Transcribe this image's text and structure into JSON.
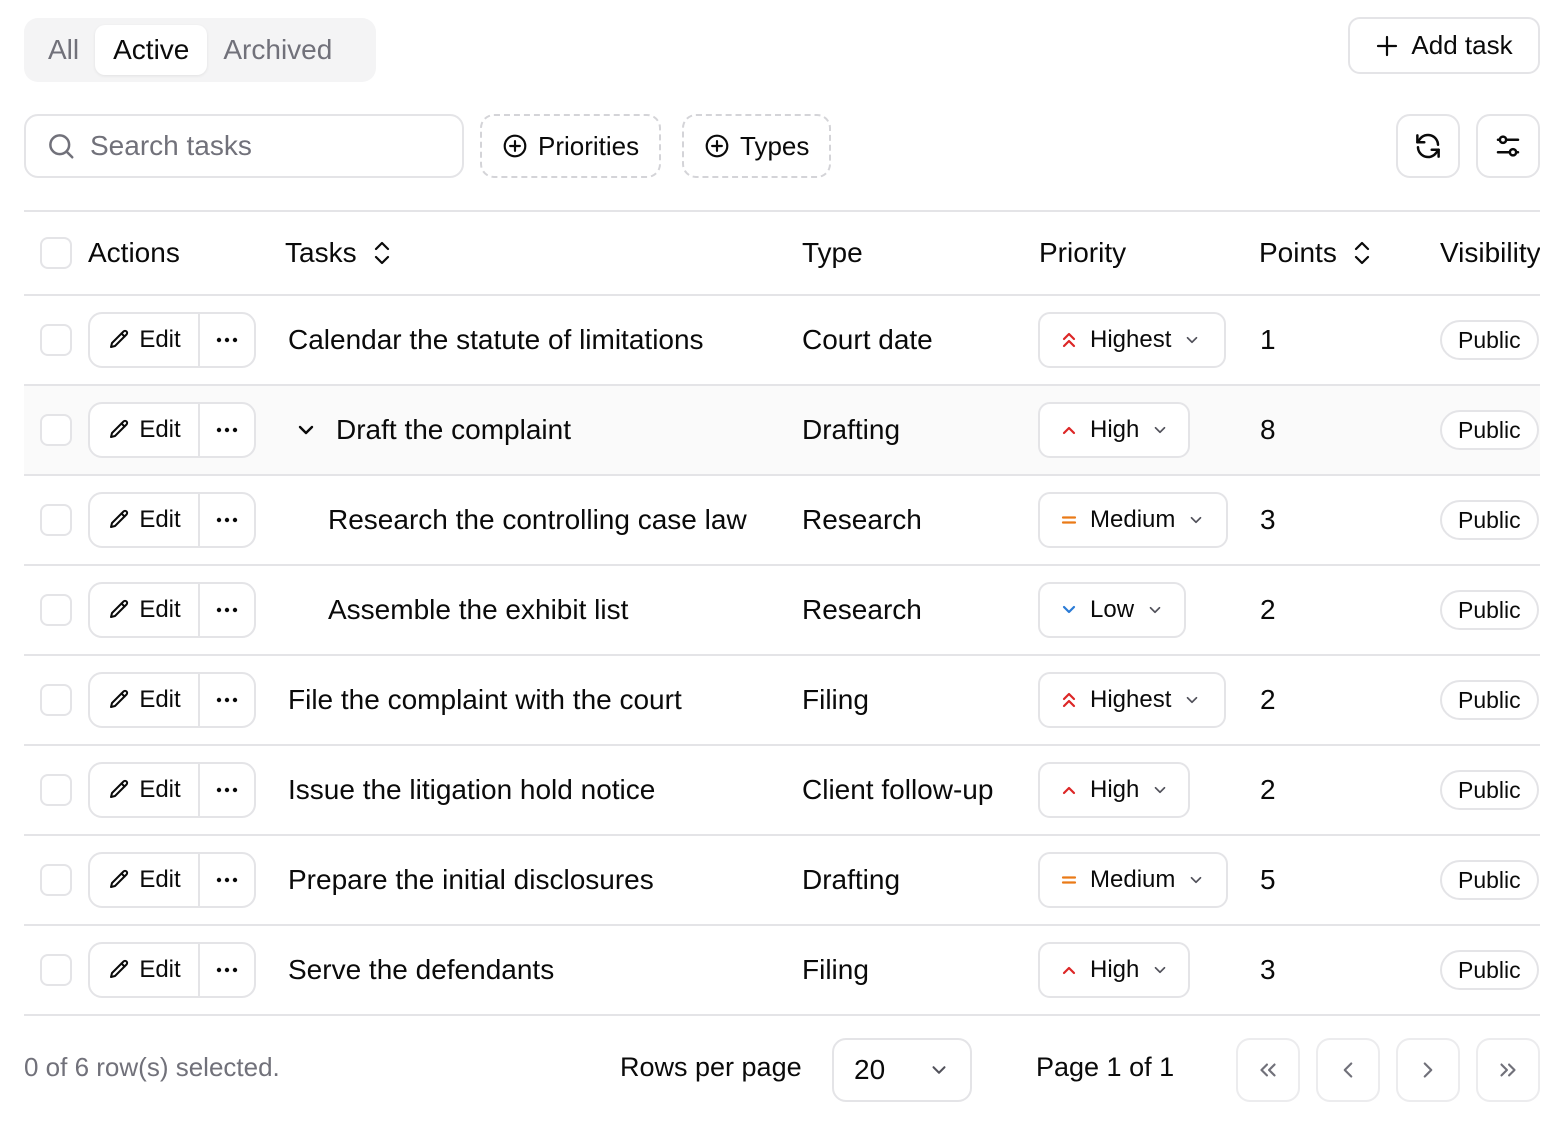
{
  "tabs": [
    {
      "label": "All"
    },
    {
      "label": "Active"
    },
    {
      "label": "Archived"
    }
  ],
  "active_tab": "Active",
  "toolbar": {
    "add_label": "Add task",
    "search_placeholder": "Search tasks",
    "priorities_label": "Priorities",
    "types_label": "Types"
  },
  "columns": {
    "actions": "Actions",
    "tasks": "Tasks",
    "type": "Type",
    "priority": "Priority",
    "points": "Points",
    "visibility": "Visibility"
  },
  "rows": [
    {
      "edit": "Edit",
      "task": "Calendar the statute of limitations",
      "type": "Court date",
      "priority": "Highest",
      "points": "1",
      "visibility": "Public"
    },
    {
      "edit": "Edit",
      "task": "Draft the complaint",
      "type": "Drafting",
      "priority": "High",
      "points": "8",
      "visibility": "Public"
    },
    {
      "edit": "Edit",
      "task": "Research the controlling case law",
      "type": "Research",
      "priority": "Medium",
      "points": "3",
      "visibility": "Public"
    },
    {
      "edit": "Edit",
      "task": "Assemble the exhibit list",
      "type": "Research",
      "priority": "Low",
      "points": "2",
      "visibility": "Public"
    },
    {
      "edit": "Edit",
      "task": "File the complaint with the court",
      "type": "Filing",
      "priority": "Highest",
      "points": "2",
      "visibility": "Public"
    },
    {
      "edit": "Edit",
      "task": "Issue the litigation hold notice",
      "type": "Client follow-up",
      "priority": "High",
      "points": "2",
      "visibility": "Public"
    },
    {
      "edit": "Edit",
      "task": "Prepare the initial disclosures",
      "type": "Drafting",
      "priority": "Medium",
      "points": "5",
      "visibility": "Public"
    },
    {
      "edit": "Edit",
      "task": "Serve the defendants",
      "type": "Filing",
      "priority": "High",
      "points": "3",
      "visibility": "Public"
    }
  ],
  "footer": {
    "selection": "0 of 6 row(s) selected.",
    "rows_per_page_label": "Rows per page",
    "rows_per_page_value": "20",
    "page_label": "Page 1 of 1"
  },
  "colors": {
    "priority_high": "#dc2626",
    "priority_medium": "#ea7a17",
    "priority_low": "#2b7bd6",
    "border": "#e4e4e7",
    "muted": "#71717a"
  },
  "icons": {
    "Highest": "chevrons-up-icon",
    "High": "chevron-up-icon",
    "Medium": "equals-icon",
    "Low": "chevron-down-icon"
  }
}
